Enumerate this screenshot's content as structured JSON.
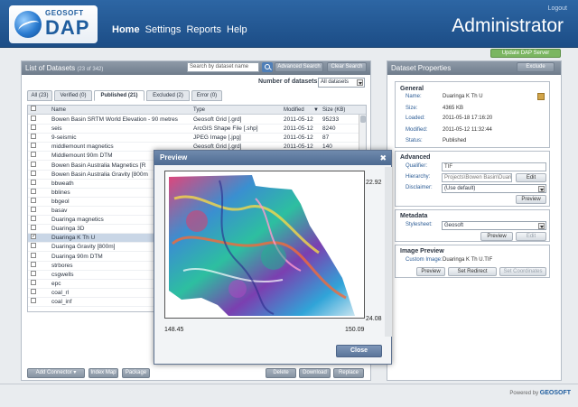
{
  "header": {
    "logo_top": "GEOSOFT",
    "logo_main": "DAP",
    "nav": [
      "Home",
      "Settings",
      "Reports",
      "Help"
    ],
    "logout": "Logout",
    "title": "Administrator",
    "update_button": "Update DAP Server"
  },
  "datasets": {
    "title": "List of Datasets",
    "count": "(23 of 342)",
    "search_placeholder": "Search by dataset name",
    "advanced_search": "Advanced Search",
    "clear_search": "Clear Search",
    "num_label": "Number of datasets:",
    "num_value": "All datasets",
    "tabs": [
      "All (23)",
      "Verified (0)",
      "Published (21)",
      "Excluded (2)",
      "Error (0)"
    ],
    "columns": [
      "Name",
      "Type",
      "Modified",
      "Size (KB)"
    ],
    "rows": [
      {
        "name": "Bowen Basin SRTM World Elevation - 90 metres",
        "type": "Geosoft Grid [.grd]",
        "modified": "2011-05-12",
        "size": "95233"
      },
      {
        "name": "seis",
        "type": "ArcGIS Shape File [.shp]",
        "modified": "2011-05-12",
        "size": "8240"
      },
      {
        "name": "9-seismic",
        "type": "JPEG Image [.jpg]",
        "modified": "2011-05-12",
        "size": "87"
      },
      {
        "name": "middlemount magnetics",
        "type": "Geosoft Grid [.grd]",
        "modified": "2011-05-12",
        "size": "140"
      },
      {
        "name": "Middlemount 90m DTM",
        "type": "",
        "modified": "",
        "size": ""
      },
      {
        "name": "Bowen Basin Australia Magnetics [R",
        "type": "",
        "modified": "",
        "size": ""
      },
      {
        "name": "Bowen Basin Australia Gravity [800m",
        "type": "",
        "modified": "",
        "size": ""
      },
      {
        "name": "bbweath",
        "type": "",
        "modified": "",
        "size": ""
      },
      {
        "name": "bblines",
        "type": "",
        "modified": "",
        "size": ""
      },
      {
        "name": "bbgeol",
        "type": "",
        "modified": "",
        "size": ""
      },
      {
        "name": "basav",
        "type": "",
        "modified": "",
        "size": ""
      },
      {
        "name": "Duaringa magnetics",
        "type": "",
        "modified": "",
        "size": ""
      },
      {
        "name": "Duaringa 3D",
        "type": "",
        "modified": "",
        "size": ""
      },
      {
        "name": "Duaringa K Th U",
        "type": "",
        "modified": "",
        "size": ""
      },
      {
        "name": "Duaringa Gravity [800m]",
        "type": "",
        "modified": "",
        "size": ""
      },
      {
        "name": "Duaringa 90m DTM",
        "type": "",
        "modified": "",
        "size": ""
      },
      {
        "name": "strbores",
        "type": "",
        "modified": "",
        "size": ""
      },
      {
        "name": "csgwells",
        "type": "",
        "modified": "",
        "size": ""
      },
      {
        "name": "epc",
        "type": "",
        "modified": "",
        "size": ""
      },
      {
        "name": "coal_rl",
        "type": "",
        "modified": "",
        "size": ""
      },
      {
        "name": "coal_inf",
        "type": "",
        "modified": "",
        "size": ""
      }
    ],
    "selected_row": "Duaringa K Th U",
    "bottom_buttons": [
      "Add Connector",
      "Index Map",
      "Package",
      "Delete",
      "Download",
      "Replace"
    ]
  },
  "properties": {
    "title": "Dataset Properties",
    "exclude": "Exclude",
    "general_title": "General",
    "general": [
      {
        "label": "Name:",
        "value": "Duaringa K Th U"
      },
      {
        "label": "Size:",
        "value": "4365 KB"
      },
      {
        "label": "Loaded:",
        "value": "2011-05-18 17:16:20"
      },
      {
        "label": "Modified:",
        "value": "2011-05-12 11:32:44"
      },
      {
        "label": "Status:",
        "value": "Published"
      }
    ],
    "advanced_title": "Advanced",
    "qualifier_label": "Qualifier:",
    "qualifier_value": "TIF",
    "hierarchy_label": "Hierarchy:",
    "hierarchy_value": "Projects\\Bowen Basin\\Duaringa",
    "edit": "Edit",
    "disclaimer_label": "Disclaimer:",
    "disclaimer_value": "(Use default)",
    "preview": "Preview",
    "metadata_title": "Metadata",
    "stylesheet_label": "Stylesheet:",
    "stylesheet_value": "Geosoft",
    "image_preview_title": "Image Preview",
    "custom_image_label": "Custom Image:",
    "custom_image_value": "Duaringa K Th U.TIF",
    "set_redirect": "Set Redirect",
    "set_coordinates": "Set Coordinates"
  },
  "preview_modal": {
    "title": "Preview",
    "top_right": "22.92",
    "bottom_right": "24.08",
    "bottom_left": "148.45",
    "bottom_right_x": "150.09",
    "close": "Close"
  },
  "footer": {
    "powered_by": "Powered by",
    "brand": "GEOSOFT"
  }
}
